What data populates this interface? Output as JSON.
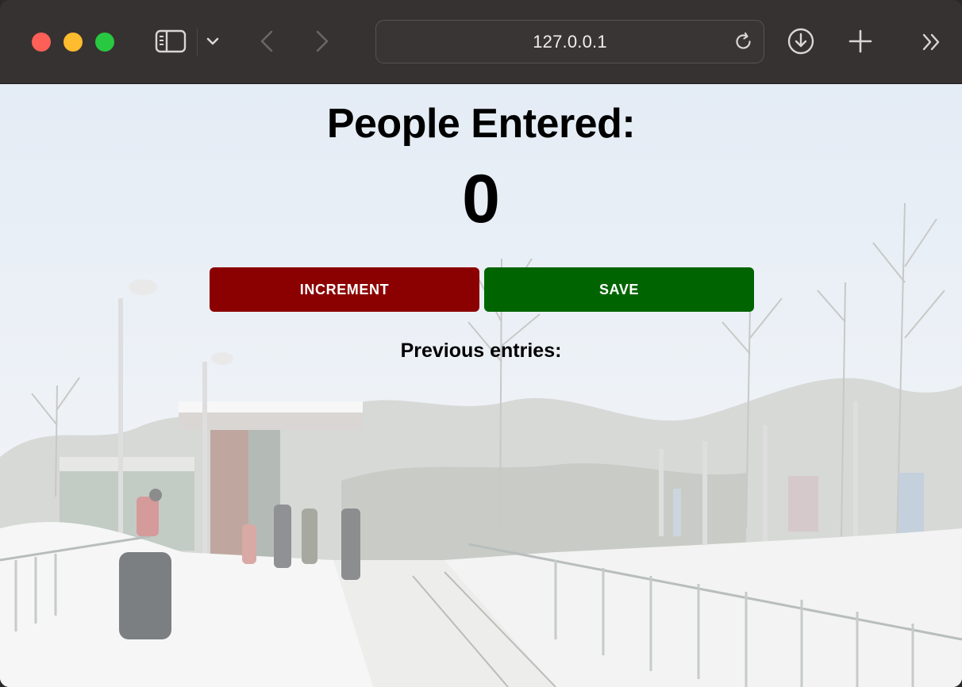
{
  "browser": {
    "address": "127.0.0.1",
    "icons": {
      "sidebar": "sidebar-icon",
      "chevron": "chevron-down-icon",
      "back": "back-arrow-icon",
      "forward": "forward-arrow-icon",
      "reload": "reload-icon",
      "download": "download-icon",
      "new_tab": "plus-icon",
      "overflow": "double-chevron-right-icon"
    },
    "traffic_lights": {
      "close": "#fe5f57",
      "minimize": "#febc2e",
      "maximize": "#28c840"
    }
  },
  "page": {
    "heading": "People Entered:",
    "count": "0",
    "increment_label": "INCREMENT",
    "save_label": "SAVE",
    "previous_heading": "Previous entries:",
    "previous_entries": [],
    "colors": {
      "increment": "#8b0000",
      "save": "#006400"
    }
  }
}
